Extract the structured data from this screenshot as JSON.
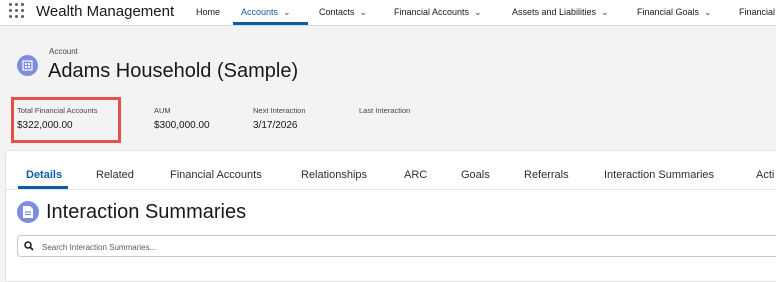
{
  "app": {
    "name": "Wealth Management"
  },
  "nav": {
    "items": [
      {
        "label": "Home"
      },
      {
        "label": "Accounts"
      },
      {
        "label": "Contacts"
      },
      {
        "label": "Financial Accounts"
      },
      {
        "label": "Assets and Liabilities"
      },
      {
        "label": "Financial Goals"
      },
      {
        "label": "Financial"
      }
    ],
    "active": "Accounts"
  },
  "record": {
    "object_label": "Account",
    "name": "Adams Household (Sample)",
    "icon": "account-icon"
  },
  "highlights": [
    {
      "label": "Total Financial Accounts",
      "value": "$322,000.00"
    },
    {
      "label": "AUM",
      "value": "$300,000.00"
    },
    {
      "label": "Next Interaction",
      "value": "3/17/2026"
    },
    {
      "label": "Last Interaction",
      "value": ""
    }
  ],
  "tabs": [
    {
      "label": "Details"
    },
    {
      "label": "Related"
    },
    {
      "label": "Financial Accounts"
    },
    {
      "label": "Relationships"
    },
    {
      "label": "ARC"
    },
    {
      "label": "Goals"
    },
    {
      "label": "Referrals"
    },
    {
      "label": "Interaction Summaries"
    },
    {
      "label": "Acti"
    }
  ],
  "section": {
    "title": "Interaction Summaries",
    "icon": "interaction-summary-icon",
    "search_placeholder": "Search Interaction Summaries..."
  },
  "colors": {
    "brand_blue": "#0b5cab",
    "icon_purple": "#7f8de1",
    "highlight_red": "#e4514a"
  }
}
